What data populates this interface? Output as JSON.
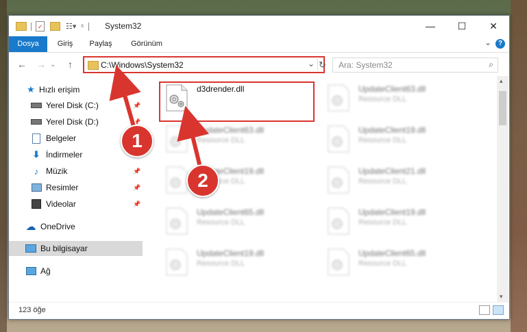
{
  "window": {
    "title": "System32",
    "minimize_glyph": "—",
    "maximize_glyph": "☐",
    "close_glyph": "✕"
  },
  "ribbon": {
    "tabs": [
      "Dosya",
      "Giriş",
      "Paylaş",
      "Görünüm"
    ],
    "active_tab": "Dosya",
    "expand_glyph": "⌄",
    "help_glyph": "?"
  },
  "address": {
    "path": "C:\\Windows\\System32",
    "search_placeholder": "Ara: System32"
  },
  "nav": {
    "items": [
      {
        "label": "Hızlı erişim",
        "icon": "star-icon",
        "pinned": false
      },
      {
        "label": "Yerel Disk (C:)",
        "icon": "drive-icon",
        "pinned": true
      },
      {
        "label": "Yerel Disk (D:)",
        "icon": "drive-icon",
        "pinned": true
      },
      {
        "label": "Belgeler",
        "icon": "document-icon",
        "pinned": true
      },
      {
        "label": "İndirmeler",
        "icon": "download-icon",
        "pinned": true
      },
      {
        "label": "Müzik",
        "icon": "music-icon",
        "pinned": true
      },
      {
        "label": "Resimler",
        "icon": "pictures-icon",
        "pinned": true
      },
      {
        "label": "Videolar",
        "icon": "video-icon",
        "pinned": true
      },
      {
        "label": "OneDrive",
        "icon": "cloud-icon",
        "pinned": false
      },
      {
        "label": "Bu bilgisayar",
        "icon": "computer-icon",
        "pinned": false,
        "selected": true
      },
      {
        "label": "Ağ",
        "icon": "network-icon",
        "pinned": false
      }
    ]
  },
  "files": {
    "highlighted": {
      "name": "d3drender.dll"
    },
    "blurred": [
      {
        "name": "UpdateClient63.dll",
        "type": "Resource DLL"
      },
      {
        "name": "UpdateClient63.dll",
        "type": "Resource DLL"
      },
      {
        "name": "UpdateClient19.dll",
        "type": "Resource DLL"
      },
      {
        "name": "UpdateClient19.dll",
        "type": "Resource DLL"
      },
      {
        "name": "UpdateClient21.dll",
        "type": "Resource DLL"
      },
      {
        "name": "UpdateClient65.dll",
        "type": "Resource DLL"
      },
      {
        "name": "UpdateClient19.dll",
        "type": "Resource DLL"
      },
      {
        "name": "UpdateClient19.dll",
        "type": "Resource DLL"
      },
      {
        "name": "UpdateClient65.dll",
        "type": "Resource DLL"
      }
    ]
  },
  "status": {
    "item_count": "123 öğe"
  },
  "callouts": {
    "step1": "1",
    "step2": "2"
  },
  "colors": {
    "accent": "#1979ca",
    "highlight": "#d9352f",
    "selected_nav": "#d9d9d9"
  }
}
